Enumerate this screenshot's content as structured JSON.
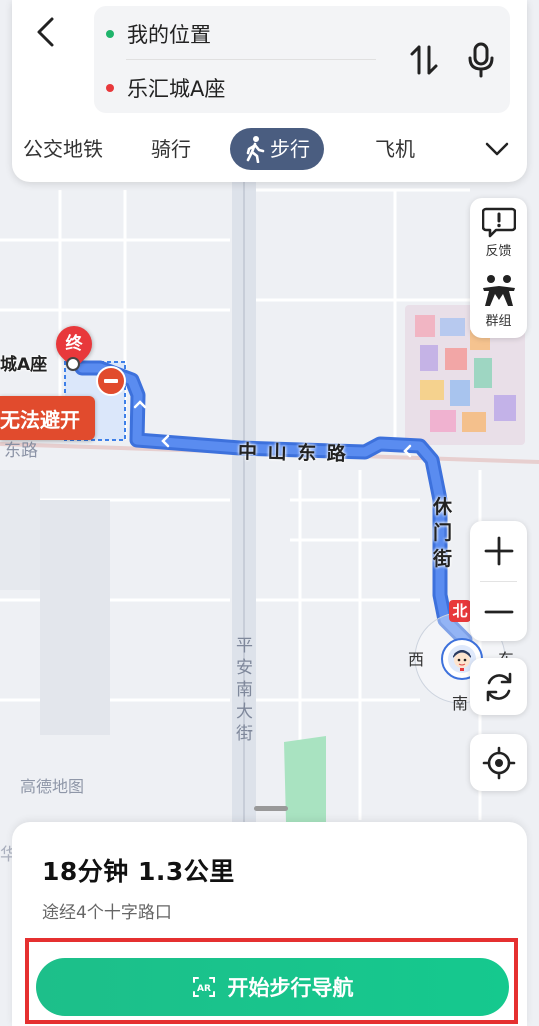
{
  "search": {
    "origin": "我的位置",
    "destination": "乐汇城A座",
    "origin_color": "#1fb46b",
    "destination_color": "#e8383b"
  },
  "tabs": [
    {
      "label": "公交地铁",
      "active": false
    },
    {
      "label": "骑行",
      "active": false
    },
    {
      "label": "步行",
      "active": true
    },
    {
      "label": "飞机",
      "active": false
    }
  ],
  "side_buttons": {
    "feedback": "反馈",
    "group": "群组"
  },
  "map": {
    "end_marker": "终",
    "destination_label": "城A座",
    "avoid_label": "无法避开",
    "road_main": "中 山 东 路",
    "road_main_faint": "东路",
    "road_vertical": "休门街",
    "road_pingan": "平安南大街",
    "compass": {
      "north": "北",
      "south": "南",
      "west": "西",
      "east": "东"
    },
    "watermark": "高德地图",
    "corner_char": "华"
  },
  "summary": {
    "time_distance": "18分钟  1.3公里",
    "via": "途经4个十字路口",
    "start_button": "开始步行导航",
    "accent_color": "#1dbf8a",
    "highlight_color": "#e53030"
  },
  "icons": [
    "back-arrow-icon",
    "swap-icon",
    "microphone-icon",
    "walk-icon",
    "chevron-down-icon",
    "feedback-icon",
    "group-icon",
    "zoom-in-icon",
    "zoom-out-icon",
    "refresh-icon",
    "locate-icon",
    "ar-icon"
  ]
}
